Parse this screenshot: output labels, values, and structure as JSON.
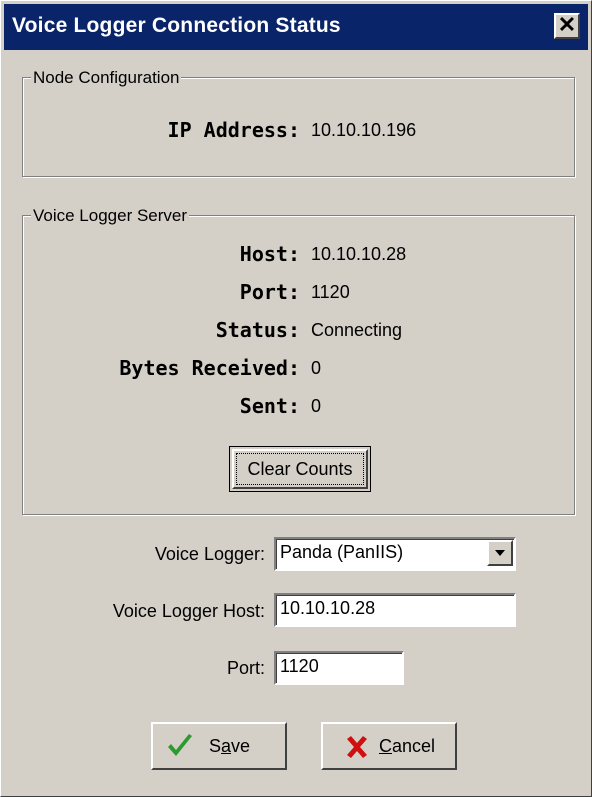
{
  "window": {
    "title": "Voice Logger Connection Status",
    "close_glyph": "✕"
  },
  "node_config": {
    "legend": "Node Configuration",
    "ip_label": "IP Address:",
    "ip_value": "10.10.10.196"
  },
  "server": {
    "legend": "Voice Logger Server",
    "host_label": "Host:",
    "host_value": "10.10.10.28",
    "port_label": "Port:",
    "port_value": "1120",
    "status_label": "Status:",
    "status_value": "Connecting",
    "bytes_label": "Bytes Received:",
    "bytes_value": "0",
    "sent_label": "Sent:",
    "sent_value": "0",
    "clear_button": "Clear Counts"
  },
  "form": {
    "logger_label": "Voice Logger:",
    "logger_value": "Panda (PanIIS)",
    "host_label": "Voice Logger Host:",
    "host_value": "10.10.10.28",
    "port_label": "Port:",
    "port_value": "1120"
  },
  "buttons": {
    "save_pre": "S",
    "save_ul": "a",
    "save_post": "ve",
    "cancel_ul": "C",
    "cancel_post": "ancel"
  },
  "icons": {
    "close": "close-icon",
    "dropdown": "chevron-down-icon",
    "save": "checkmark-icon",
    "cancel": "x-icon"
  },
  "colors": {
    "titlebar": "#0a246a",
    "face": "#d4d0c8",
    "check": "#2e9a2e",
    "cross": "#d01010"
  }
}
